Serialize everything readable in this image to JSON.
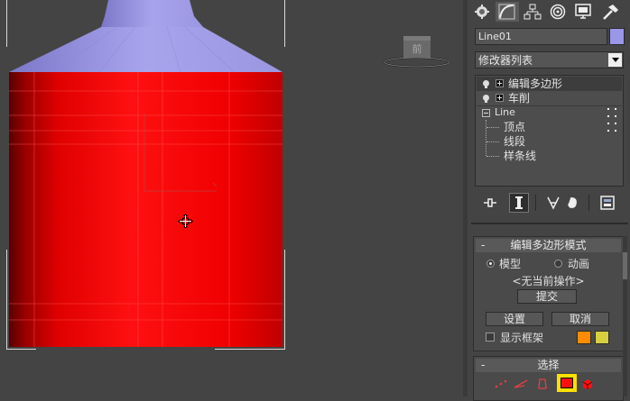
{
  "viewport": {
    "viewcube_label": "前",
    "colors": {
      "object": "#ff0000",
      "object_top": "#9a96e8",
      "background": "#444444"
    }
  },
  "command_panel": {
    "tabs": [
      {
        "icon": "create-icon"
      },
      {
        "icon": "modify-icon",
        "active": true
      },
      {
        "icon": "hierarchy-icon"
      },
      {
        "icon": "motion-icon"
      },
      {
        "icon": "display-icon"
      },
      {
        "icon": "utilities-icon"
      }
    ],
    "object_name": "Line01",
    "object_color": "#9a96e8",
    "modifier_list_label": "修改器列表",
    "stack": {
      "items": [
        {
          "label": "编辑多边形"
        },
        {
          "label": "车削"
        }
      ],
      "base": {
        "label": "Line",
        "children": [
          "顶点",
          "线段",
          "样条线"
        ]
      }
    },
    "edit_poly_mode": {
      "title": "编辑多边形模式",
      "model_label": "模型",
      "animate_label": "动画",
      "status": "<无当前操作>",
      "commit_label": "提交",
      "settings_label": "设置",
      "cancel_label": "取消",
      "show_cage_label": "显示框架",
      "cage_colors": [
        "#ff8c00",
        "#d6d040"
      ]
    },
    "selection": {
      "title": "选择"
    }
  }
}
